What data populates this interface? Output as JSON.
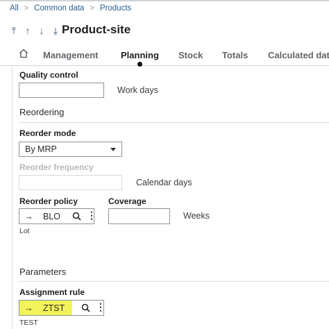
{
  "breadcrumb": {
    "items": [
      "All",
      "Common data",
      "Products"
    ]
  },
  "nav": {
    "first": "⤒",
    "up": "↑",
    "down": "↓",
    "last": "⤓"
  },
  "page_title": "Product-site",
  "tabs": [
    {
      "label": "Management"
    },
    {
      "label": "Planning",
      "active": true
    },
    {
      "label": "Stock"
    },
    {
      "label": "Totals"
    },
    {
      "label": "Calculated dat"
    }
  ],
  "quality_control": {
    "label": "Quality control",
    "value": "",
    "unit": "Work days"
  },
  "reordering": {
    "section_title": "Reordering",
    "reorder_mode": {
      "label": "Reorder mode",
      "value": "By MRP"
    },
    "reorder_frequency": {
      "label": "Reorder frequency",
      "value": "",
      "unit": "Calendar days",
      "disabled": true
    },
    "reorder_policy": {
      "label": "Reorder policy",
      "value": "BLO",
      "description": "Lot"
    },
    "coverage": {
      "label": "Coverage",
      "value": "",
      "unit": "Weeks"
    }
  },
  "parameters": {
    "section_title": "Parameters",
    "assignment_rule": {
      "label": "Assignment rule",
      "value": "ZTST",
      "description": "TEST",
      "highlight": "#f2f25a"
    }
  },
  "colors": {
    "link": "#2a5d8c",
    "highlight": "#f2f25a",
    "border": "#8c9399"
  }
}
